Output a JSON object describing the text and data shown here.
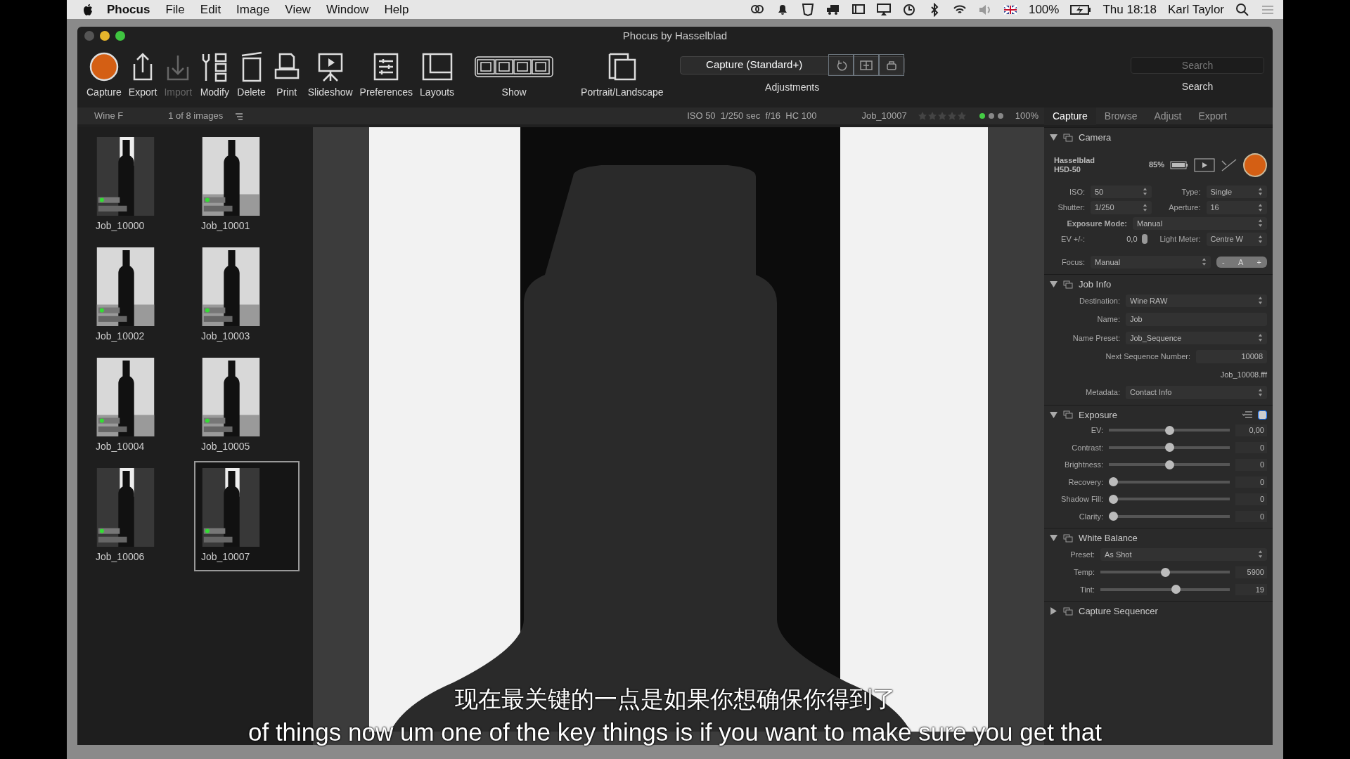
{
  "menu_bar": {
    "app": "Phocus",
    "items": [
      "File",
      "Edit",
      "Image",
      "View",
      "Window",
      "Help"
    ],
    "battery": "100%",
    "clock": "Thu 18:18",
    "user": "Karl Taylor"
  },
  "window": {
    "title": "Phocus by Hasselblad"
  },
  "toolbar": [
    {
      "kind": "capture",
      "label": "Capture",
      "disabled": false
    },
    {
      "kind": "export",
      "label": "Export",
      "disabled": false
    },
    {
      "kind": "import",
      "label": "Import",
      "disabled": true
    },
    {
      "kind": "modify",
      "label": "Modify",
      "disabled": false
    },
    {
      "kind": "delete",
      "label": "Delete",
      "disabled": false
    },
    {
      "kind": "print",
      "label": "Print",
      "disabled": false
    },
    {
      "kind": "slideshow",
      "label": "Slideshow",
      "disabled": false
    },
    {
      "kind": "preferences",
      "label": "Preferences",
      "disabled": false
    },
    {
      "kind": "layouts",
      "label": "Layouts",
      "disabled": false
    },
    {
      "kind": "show",
      "label": "Show",
      "disabled": false
    },
    {
      "kind": "orientation",
      "label": "Portrait/Landscape",
      "disabled": false
    }
  ],
  "adjustments": {
    "preset": "Capture (Standard+)",
    "label": "Adjustments"
  },
  "search": {
    "placeholder": "Search",
    "label": "Search"
  },
  "browser_bar": {
    "folder": "Wine F",
    "count": "1 of 8 images"
  },
  "image_info": {
    "exif": "ISO 50  1/250 sec  f/16  HC 100",
    "filename": "Job_10007",
    "zoom": "100%"
  },
  "tabs": [
    {
      "label": "Capture",
      "selected": true
    },
    {
      "label": "Browse",
      "selected": false
    },
    {
      "label": "Adjust",
      "selected": false
    },
    {
      "label": "Export",
      "selected": false
    }
  ],
  "thumbnails": [
    {
      "name": "Job_10000",
      "selected": false
    },
    {
      "name": "Job_10001",
      "selected": false
    },
    {
      "name": "Job_10002",
      "selected": false
    },
    {
      "name": "Job_10003",
      "selected": false
    },
    {
      "name": "Job_10004",
      "selected": false
    },
    {
      "name": "Job_10005",
      "selected": false
    },
    {
      "name": "Job_10006",
      "selected": false
    },
    {
      "name": "Job_10007",
      "selected": true
    }
  ],
  "camera": {
    "title": "Camera",
    "expanded": true,
    "model": [
      "Hasselblad",
      "H5D-50"
    ],
    "battery": "85%",
    "rows": [
      [
        {
          "label": "ISO:",
          "value": "50",
          "kind": "stepper"
        },
        {
          "label": "Type:",
          "value": "Single",
          "kind": "popup"
        }
      ],
      [
        {
          "label": "Shutter:",
          "value": "1/250",
          "kind": "stepper"
        },
        {
          "label": "Aperture:",
          "value": "16",
          "kind": "popup"
        }
      ],
      [
        {
          "label": "Exposure Mode:",
          "value": "Manual",
          "kind": "popup"
        }
      ],
      [
        {
          "label": "EV +/-:",
          "value": "0,0",
          "kind": "pill"
        },
        {
          "label": "Light Meter:",
          "value": "Centre W",
          "kind": "popup"
        }
      ],
      [
        {
          "label": "Focus:",
          "value": "Manual",
          "kind": "popup"
        }
      ]
    ],
    "focus_buttons": [
      "-",
      "A",
      "+"
    ]
  },
  "job_info": {
    "title": "Job Info",
    "expanded": true,
    "fields": [
      {
        "label": "Destination:",
        "value": "Wine RAW",
        "kind": "popup"
      },
      {
        "label": "Name:",
        "value": "Job",
        "kind": "input"
      },
      {
        "label": "Name Preset:",
        "value": "Job_Sequence",
        "kind": "popup"
      },
      {
        "label": "Next Sequence Number:",
        "value": "10008",
        "kind": "number"
      },
      {
        "label": "Metadata:",
        "value": "Contact Info",
        "kind": "popup"
      }
    ],
    "filename": "Job_10008.fff"
  },
  "exposure": {
    "title": "Exposure",
    "expanded": true,
    "enabled": true,
    "sliders": [
      {
        "label": "EV:",
        "level": 0.5,
        "reading": "0,00"
      },
      {
        "label": "Contrast:",
        "level": 0.5,
        "reading": "0"
      },
      {
        "label": "Brightness:",
        "level": 0.5,
        "reading": "0"
      },
      {
        "label": "Recovery:",
        "level": 0,
        "reading": "0"
      },
      {
        "label": "Shadow Fill:",
        "level": 0,
        "reading": "0"
      },
      {
        "label": "Clarity:",
        "level": 0,
        "reading": "0"
      }
    ]
  },
  "white_balance": {
    "title": "White Balance",
    "expanded": true,
    "preset_label": "Preset:",
    "preset": "As Shot",
    "sliders": [
      {
        "label": "Temp:",
        "level": 0.5,
        "reading": "5900"
      },
      {
        "label": "Tint:",
        "level": 0.59,
        "reading": "19"
      }
    ]
  },
  "capture_sequencer": {
    "title": "Capture Sequencer",
    "expanded": false
  },
  "subtitles": {
    "chinese": "现在最关键的一点是如果你想确保你得到了",
    "english": "of things now um one of the key things is if you want to make sure you get that"
  }
}
